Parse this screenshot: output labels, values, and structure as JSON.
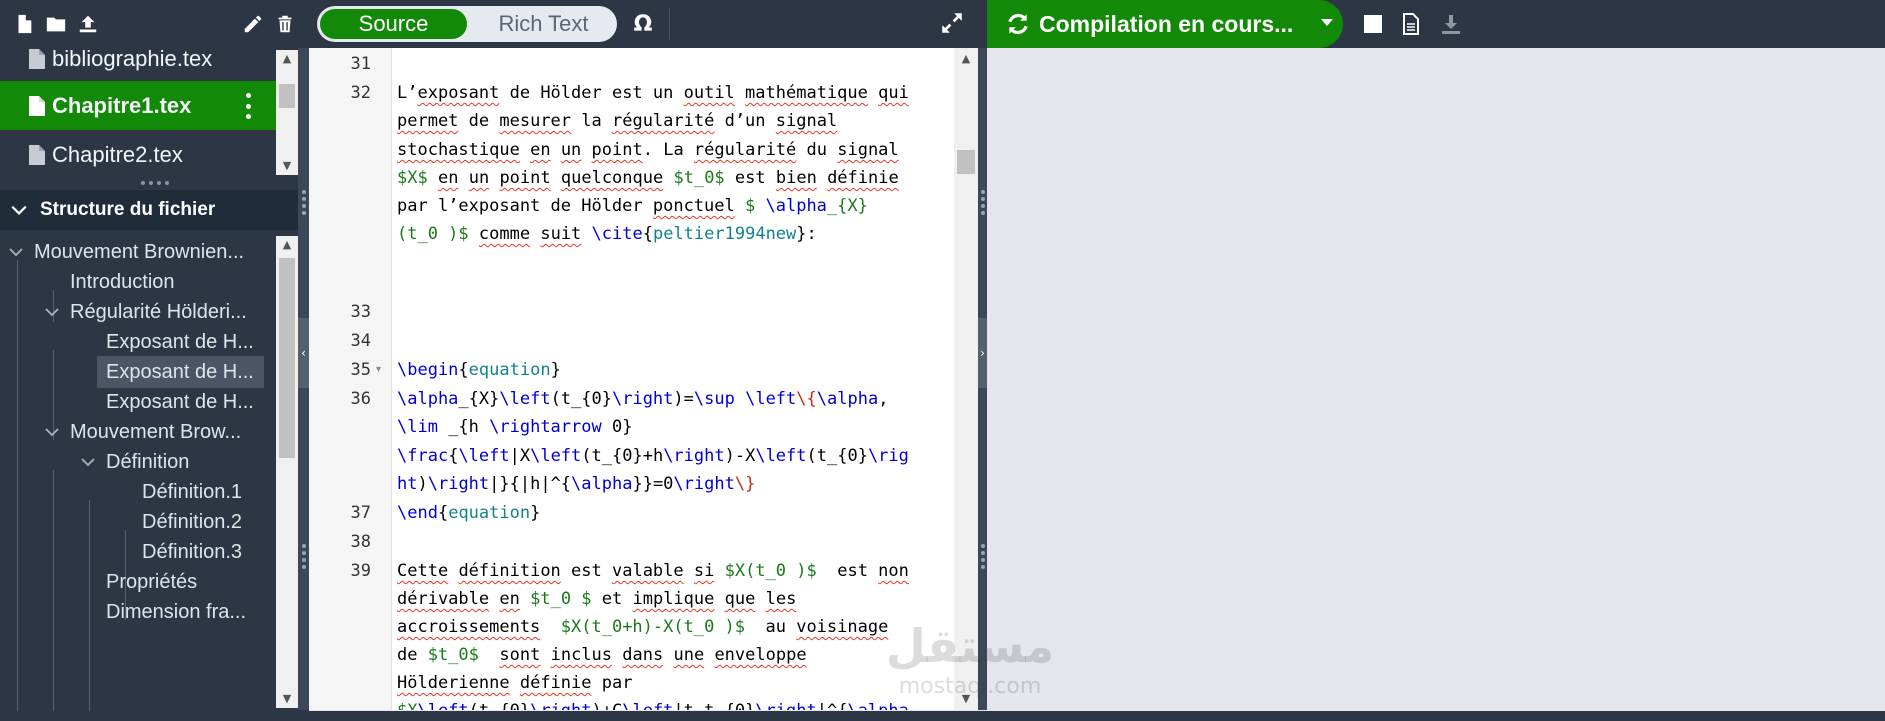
{
  "left_toolbar": {
    "icons": [
      "new-file-icon",
      "new-folder-icon",
      "upload-icon",
      "rename-icon",
      "delete-icon"
    ]
  },
  "files": [
    {
      "name": "bibliographie.tex",
      "selected": false
    },
    {
      "name": "Chapitre1.tex",
      "selected": true
    },
    {
      "name": "Chapitre2.tex",
      "selected": false
    }
  ],
  "outline": {
    "header": "Structure du fichier",
    "items": [
      {
        "label": "Mouvement Brownien...",
        "level": 0,
        "expanded": true
      },
      {
        "label": "Introduction",
        "level": 1,
        "expanded": null
      },
      {
        "label": "Régularité Hölderi...",
        "level": 1,
        "expanded": true
      },
      {
        "label": "Exposant de H...",
        "level": 2,
        "expanded": null
      },
      {
        "label": "Exposant de H...",
        "level": 2,
        "expanded": null,
        "selected": true
      },
      {
        "label": "Exposant de H...",
        "level": 2,
        "expanded": null
      },
      {
        "label": "Mouvement Brow...",
        "level": 1,
        "expanded": true
      },
      {
        "label": "Définition",
        "level": 2,
        "expanded": true
      },
      {
        "label": "Définition.1",
        "level": 3,
        "expanded": null
      },
      {
        "label": "Définition.2",
        "level": 3,
        "expanded": null
      },
      {
        "label": "Définition.3",
        "level": 3,
        "expanded": null
      },
      {
        "label": "Propriétés",
        "level": 2,
        "expanded": null
      },
      {
        "label": "Dimension fra...",
        "level": 2,
        "expanded": null
      }
    ]
  },
  "editor_toolbar": {
    "source_label": "Source",
    "richtext_label": "Rich Text",
    "symbol_label": "Ω",
    "active_mode": "Source"
  },
  "editor": {
    "gutter": [
      {
        "n": "31",
        "line": 0
      },
      {
        "n": "32",
        "line": 1
      },
      {
        "n": "33",
        "line": 7
      },
      {
        "n": "34",
        "line": 8
      },
      {
        "n": "35",
        "line": 9,
        "fold": true
      },
      {
        "n": "36",
        "line": 10
      },
      {
        "n": "37",
        "line": 14
      },
      {
        "n": "38",
        "line": 15
      },
      {
        "n": "39",
        "line": 16
      }
    ]
  },
  "pdf_toolbar": {
    "compile_label": "Compilation en cours...",
    "icons": [
      "stop-icon",
      "document-icon",
      "download-icon"
    ]
  },
  "watermark": {
    "arabic": "مستقل",
    "latin": "mostaql.com"
  },
  "colors": {
    "panel": "#2c3645",
    "accent_green": "#138a07",
    "outline_header": "#212c3b",
    "editor_bg": "#ffffff",
    "pdf_bg": "#e4e6ec"
  }
}
